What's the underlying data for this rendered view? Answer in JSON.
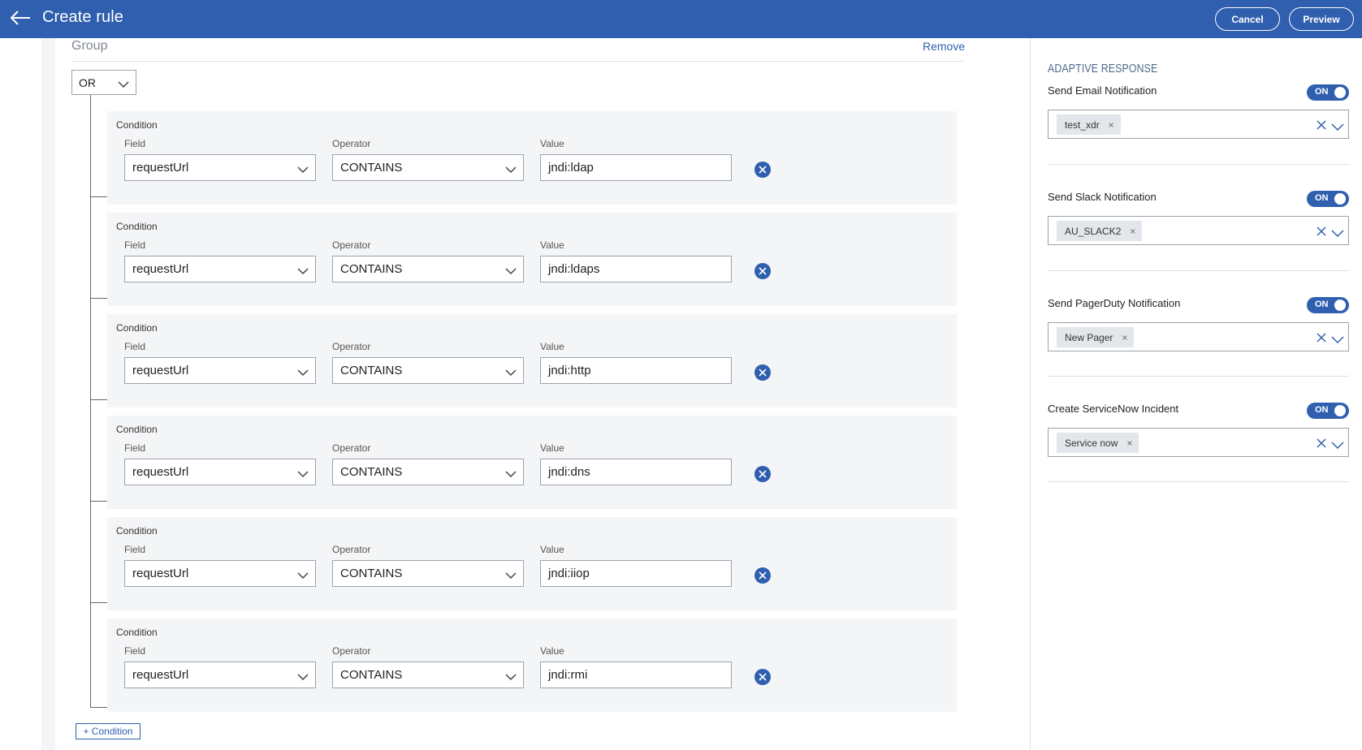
{
  "header": {
    "title": "Create rule",
    "cancel_label": "Cancel",
    "preview_label": "Preview"
  },
  "group": {
    "label": "Group",
    "remove_label": "Remove",
    "operator": "OR"
  },
  "conditions": [
    {
      "title": "Condition",
      "field_label": "Field",
      "field_value": "requestUrl",
      "operator_label": "Operator",
      "operator_value": "CONTAINS",
      "value_label": "Value",
      "value": "jndi:ldap"
    },
    {
      "title": "Condition",
      "field_label": "Field",
      "field_value": "requestUrl",
      "operator_label": "Operator",
      "operator_value": "CONTAINS",
      "value_label": "Value",
      "value": "jndi:ldaps"
    },
    {
      "title": "Condition",
      "field_label": "Field",
      "field_value": "requestUrl",
      "operator_label": "Operator",
      "operator_value": "CONTAINS",
      "value_label": "Value",
      "value": "jndi:http"
    },
    {
      "title": "Condition",
      "field_label": "Field",
      "field_value": "requestUrl",
      "operator_label": "Operator",
      "operator_value": "CONTAINS",
      "value_label": "Value",
      "value": "jndi:dns"
    },
    {
      "title": "Condition",
      "field_label": "Field",
      "field_value": "requestUrl",
      "operator_label": "Operator",
      "operator_value": "CONTAINS",
      "value_label": "Value",
      "value": "jndi:iiop"
    },
    {
      "title": "Condition",
      "field_label": "Field",
      "field_value": "requestUrl",
      "operator_label": "Operator",
      "operator_value": "CONTAINS",
      "value_label": "Value",
      "value": "jndi:rmi"
    }
  ],
  "add_condition_label": "+ Condition",
  "adaptive_response": {
    "title": "ADAPTIVE RESPONSE",
    "items": [
      {
        "label": "Send Email Notification",
        "toggle": "ON",
        "chip": "test_xdr"
      },
      {
        "label": "Send Slack Notification",
        "toggle": "ON",
        "chip": "AU_SLACK2"
      },
      {
        "label": "Send PagerDuty Notification",
        "toggle": "ON",
        "chip": "New Pager"
      },
      {
        "label": "Create ServiceNow Incident",
        "toggle": "ON",
        "chip": "Service now"
      }
    ]
  },
  "colors": {
    "header": "#2f5fae",
    "accent": "#2f5fae",
    "condition_bg": "#f4f5f7",
    "chip_bg": "#e3e6ea"
  },
  "icons": {
    "back": "arrow-left-icon",
    "dropdown": "chevron-down-icon",
    "remove_condition": "close-circle-icon",
    "clear": "close-icon",
    "chip_remove": "close-icon"
  }
}
